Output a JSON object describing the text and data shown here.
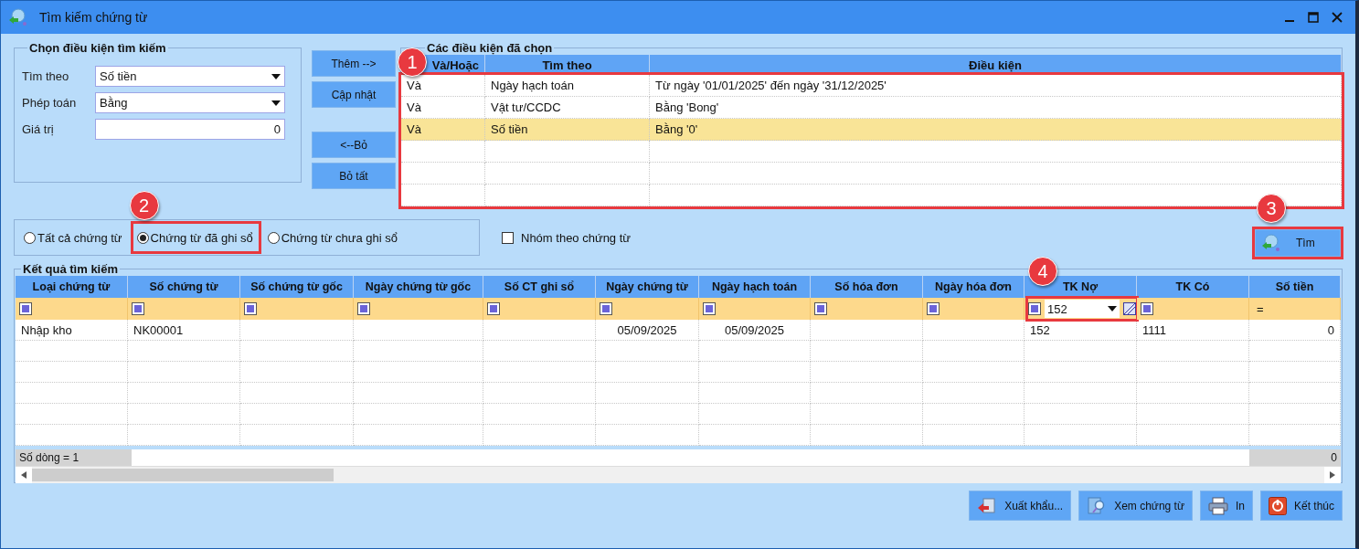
{
  "window": {
    "title": "Tìm kiếm chứng từ"
  },
  "criteria": {
    "title": "Chọn điều kiện tìm kiếm",
    "fields": [
      {
        "label": "Tìm theo",
        "kind": "dropdown",
        "value": "Số tiền"
      },
      {
        "label": "Phép toán",
        "kind": "dropdown",
        "value": "Bằng"
      },
      {
        "label": "Giá trị",
        "kind": "number",
        "value": "0"
      }
    ]
  },
  "action_buttons": [
    {
      "label": "Thêm -->"
    },
    {
      "label": "Cập nhật"
    },
    {
      "label": "<--Bỏ"
    },
    {
      "label": "Bỏ tất"
    }
  ],
  "selected_conditions": {
    "title": "Các điều kiện đã chọn",
    "annotation": "1",
    "columns": [
      "Và/Hoặc",
      "Tìm theo",
      "Điều kiện"
    ],
    "rows": [
      {
        "cells": [
          "Và",
          "Ngày hạch toán",
          "Từ ngày '01/01/2025' đến ngày '31/12/2025'"
        ],
        "selected": false
      },
      {
        "cells": [
          "Và",
          "Vật tư/CCDC",
          "Bằng 'Bong'"
        ],
        "selected": false
      },
      {
        "cells": [
          "Và",
          "Số tiền",
          "Bằng '0'"
        ],
        "selected": true
      }
    ]
  },
  "document_filter": {
    "options": [
      {
        "label": "Tất cả chứng từ",
        "selected": false
      },
      {
        "label": "Chứng từ đã ghi sổ",
        "selected": true,
        "annotation": "2"
      },
      {
        "label": "Chứng từ chưa ghi sổ",
        "selected": false
      }
    ]
  },
  "group_checkbox": {
    "label": "Nhóm theo chứng từ",
    "checked": false
  },
  "search_button": {
    "label": "Tìm",
    "annotation": "3"
  },
  "results": {
    "title": "Kết quả tìm kiếm",
    "columns": [
      {
        "label": "Loại chứng từ",
        "kind": "text",
        "filter": {
          "kind": "icon"
        }
      },
      {
        "label": "Số chứng từ",
        "kind": "text",
        "filter": {
          "kind": "icon"
        }
      },
      {
        "label": "Số chứng từ gốc",
        "kind": "text",
        "filter": {
          "kind": "icon"
        }
      },
      {
        "label": "Ngày chứng từ gốc",
        "kind": "date",
        "filter": {
          "kind": "icon"
        }
      },
      {
        "label": "Số CT ghi sổ",
        "kind": "text",
        "filter": {
          "kind": "icon"
        }
      },
      {
        "label": "Ngày chứng từ",
        "kind": "date",
        "filter": {
          "kind": "icon"
        }
      },
      {
        "label": "Ngày hạch toán",
        "kind": "date",
        "filter": {
          "kind": "icon"
        }
      },
      {
        "label": "Số hóa đơn",
        "kind": "text",
        "filter": {
          "kind": "icon"
        }
      },
      {
        "label": "Ngày hóa đơn",
        "kind": "date",
        "filter": {
          "kind": "icon"
        }
      },
      {
        "label": "TK Nợ",
        "kind": "text",
        "filter": {
          "kind": "dropdown",
          "value": "152",
          "annotation": "4"
        }
      },
      {
        "label": "TK Có",
        "kind": "text",
        "filter": {
          "kind": "icon"
        }
      },
      {
        "label": "Số tiền",
        "kind": "amount",
        "filter": {
          "kind": "operator",
          "text": "="
        }
      }
    ],
    "rows": [
      [
        "Nhập kho",
        "NK00001",
        null,
        null,
        null,
        "05/09/2025",
        "05/09/2025",
        null,
        null,
        "152",
        "1111",
        "0"
      ]
    ],
    "footer": {
      "row_count": "Số dòng = 1",
      "total": "0"
    }
  },
  "bottom_buttons": [
    {
      "label": "Xuất khẩu...",
      "kind": "export"
    },
    {
      "label": "Xem chứng từ",
      "kind": "view"
    },
    {
      "label": "In",
      "kind": "print"
    },
    {
      "label": "Kết thúc",
      "kind": "exit"
    }
  ]
}
